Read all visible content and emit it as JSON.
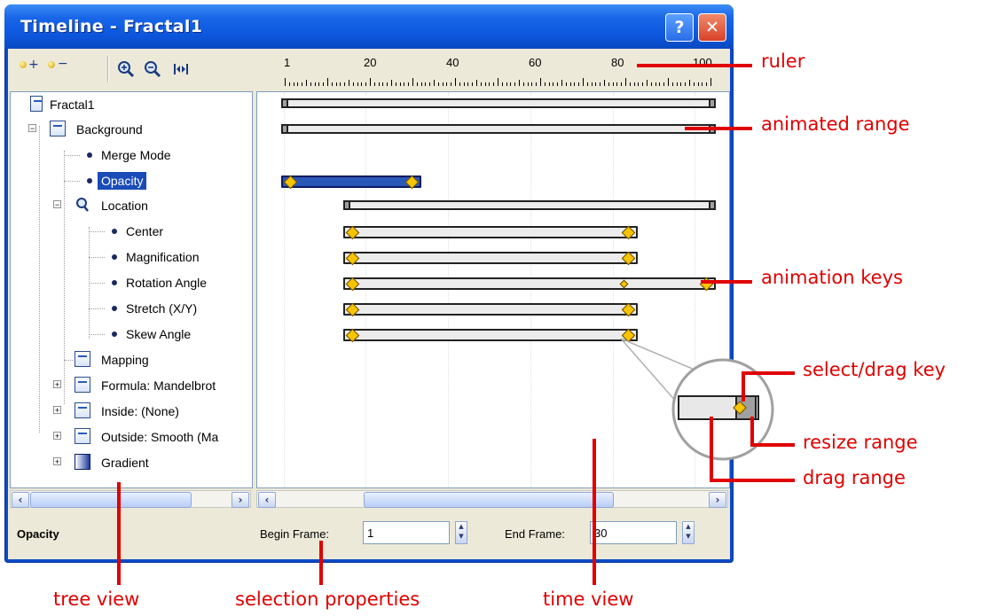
{
  "window": {
    "title": "Timeline - Fractal1",
    "help_label": "?",
    "close_label": "✕"
  },
  "toolbar": {
    "buttons": [
      "add-key",
      "remove-key",
      "zoom-in",
      "zoom-out",
      "zoom-fit"
    ]
  },
  "ruler": {
    "labels": [
      "1",
      "20",
      "40",
      "60",
      "80",
      "100"
    ]
  },
  "tree": {
    "items": [
      {
        "label": "Fractal1"
      },
      {
        "label": "Background"
      },
      {
        "label": "Merge Mode"
      },
      {
        "label": "Opacity"
      },
      {
        "label": "Location"
      },
      {
        "label": "Center"
      },
      {
        "label": "Magnification"
      },
      {
        "label": "Rotation Angle"
      },
      {
        "label": "Stretch (X/Y)"
      },
      {
        "label": "Skew Angle"
      },
      {
        "label": "Mapping"
      },
      {
        "label": "Formula: Mandelbrot"
      },
      {
        "label": "Inside: (None)"
      },
      {
        "label": "Outside: Smooth (Ma"
      },
      {
        "label": "Gradient"
      }
    ]
  },
  "properties": {
    "selected_name": "Opacity",
    "begin_label": "Begin Frame:",
    "begin_value": "1",
    "end_label": "End Frame:",
    "end_value": "30"
  },
  "annotations": {
    "ruler": "ruler",
    "animated_range": "animated range",
    "animation_keys": "animation keys",
    "select_drag_key": "select/drag key",
    "resize_range": "resize range",
    "drag_range": "drag range",
    "tree_view": "tree view",
    "selection_properties": "selection properties",
    "time_view": "time view"
  },
  "colors": {
    "accent": "#0a4bc4",
    "annotation": "#e00000",
    "selection": "#1a4cb8",
    "key": "#f6c400"
  }
}
